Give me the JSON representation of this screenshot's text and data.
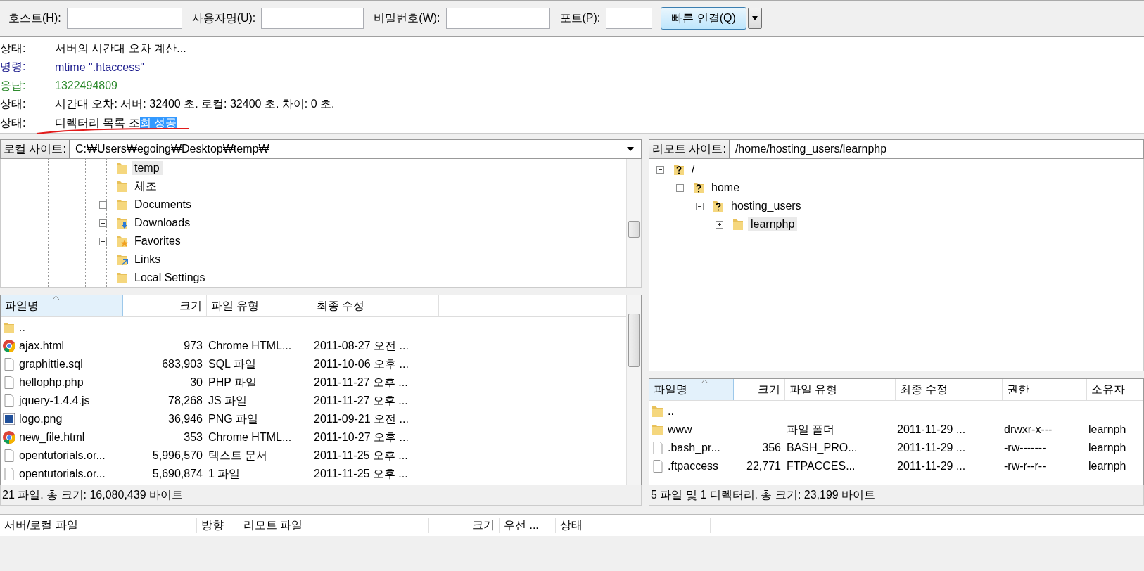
{
  "toolbar": {
    "fields": [
      {
        "label": "호스트(H):"
      },
      {
        "label": "사용자명(U):"
      },
      {
        "label": "비밀번호(W):"
      },
      {
        "label": "포트(P):"
      }
    ],
    "connect_button": "빠른 연결(Q)"
  },
  "log": [
    {
      "kind": "status",
      "label": "상태:",
      "message": "서버의 시간대 오차 계산..."
    },
    {
      "kind": "command",
      "label": "명령:",
      "message": "mtime \".htaccess\""
    },
    {
      "kind": "response",
      "label": "응답:",
      "message": "1322494809"
    },
    {
      "kind": "status",
      "label": "상태:",
      "message": "시간대 오차: 서버: 32400 초. 로컬: 32400 초. 차이: 0 초."
    },
    {
      "kind": "status",
      "label": "상태:",
      "message": "디렉터리 목록 조",
      "selection": "회 성공"
    }
  ],
  "local": {
    "site_label": "로컬 사이트:",
    "path": "C:₩Users₩egoing₩Desktop₩temp₩",
    "tree": [
      {
        "children": [
          {
            "label": "temp",
            "kind": "folder",
            "selected": true
          },
          {
            "label": "체조",
            "kind": "folder",
            "selected": false
          }
        ]
      },
      {
        "label": "Documents",
        "kind": "folder",
        "expanded": false,
        "selected": false
      },
      {
        "label": "Downloads",
        "kind": "downloads",
        "expanded": false,
        "selected": false
      },
      {
        "label": "Favorites",
        "kind": "favorites",
        "expanded": false,
        "selected": false
      },
      {
        "label": "Links",
        "kind": "links",
        "selected": false
      },
      {
        "label": "Local Settings",
        "kind": "folder",
        "selected": false
      }
    ],
    "columns": [
      {
        "label": "파일명",
        "sorted": true
      },
      {
        "label": "크기",
        "sorted": false
      },
      {
        "label": "파일 유형",
        "sorted": false
      },
      {
        "label": "최종 수정",
        "sorted": false
      }
    ],
    "files": [
      {
        "kind": "folder",
        "cells": [
          ".."
        ]
      },
      {
        "kind": "chrome",
        "cells": [
          "ajax.html",
          "973",
          "Chrome HTML...",
          "2011-08-27 오전 ..."
        ]
      },
      {
        "kind": "text",
        "cells": [
          "graphittie.sql",
          "683,903",
          "SQL 파일",
          "2011-10-06 오후 ..."
        ]
      },
      {
        "kind": "text",
        "cells": [
          "hellophp.php",
          "30",
          "PHP 파일",
          "2011-11-27 오후 ..."
        ]
      },
      {
        "kind": "text",
        "cells": [
          "jquery-1.4.4.js",
          "78,268",
          "JS 파일",
          "2011-11-27 오후 ..."
        ]
      },
      {
        "kind": "image",
        "cells": [
          "logo.png",
          "36,946",
          "PNG 파일",
          "2011-09-21 오전 ..."
        ]
      },
      {
        "kind": "chrome",
        "cells": [
          "new_file.html",
          "353",
          "Chrome HTML...",
          "2011-10-27 오후 ..."
        ]
      },
      {
        "kind": "text",
        "cells": [
          "opentutorials.or...",
          "5,996,570",
          "텍스트 문서",
          "2011-11-25 오후 ..."
        ]
      },
      {
        "kind": "text",
        "cells": [
          "opentutorials.or...",
          "5,690,874",
          "1 파일",
          "2011-11-25 오후 ..."
        ]
      }
    ],
    "status": "21 파일. 총 크기: 16,080,439 바이트"
  },
  "remote": {
    "site_label": "리모트 사이트:",
    "path": "/home/hosting_users/learnphp",
    "tree": [
      {
        "label": "/",
        "kind": "unknown",
        "expanded": true,
        "selected": false,
        "children": [
          {
            "label": "home",
            "kind": "unknown",
            "expanded": true,
            "selected": false,
            "children": [
              {
                "label": "hosting_users",
                "kind": "unknown",
                "expanded": true,
                "selected": false,
                "children": [
                  {
                    "label": "learnphp",
                    "kind": "folder",
                    "expanded": false,
                    "selected": true
                  }
                ]
              }
            ]
          }
        ]
      }
    ],
    "columns": [
      {
        "label": "파일명",
        "sorted": true
      },
      {
        "label": "크기",
        "sorted": false
      },
      {
        "label": "파일 유형",
        "sorted": false
      },
      {
        "label": "최종 수정",
        "sorted": false
      },
      {
        "label": "권한",
        "sorted": false
      },
      {
        "label": "소유자",
        "sorted": false
      }
    ],
    "files": [
      {
        "kind": "folder",
        "cells": [
          ".."
        ]
      },
      {
        "kind": "folder",
        "cells": [
          "www",
          "",
          "파일 폴더",
          "2011-11-29 ...",
          "drwxr-x---",
          "learnph"
        ]
      },
      {
        "kind": "text",
        "cells": [
          ".bash_pr...",
          "356",
          "BASH_PRO...",
          "2011-11-29 ...",
          "-rw-------",
          "learnph"
        ]
      },
      {
        "kind": "text",
        "cells": [
          ".ftpaccess",
          "22,771",
          "FTPACCES...",
          "2011-11-29 ...",
          "-rw-r--r--",
          "learnph"
        ]
      }
    ],
    "status": "5 파일 및 1 디렉터리. 총 크기: 23,199 바이트"
  },
  "queue": {
    "columns": [
      "서버/로컬 파일",
      "방향",
      "리모트 파일",
      "크기",
      "우선 ...",
      "상태"
    ]
  }
}
